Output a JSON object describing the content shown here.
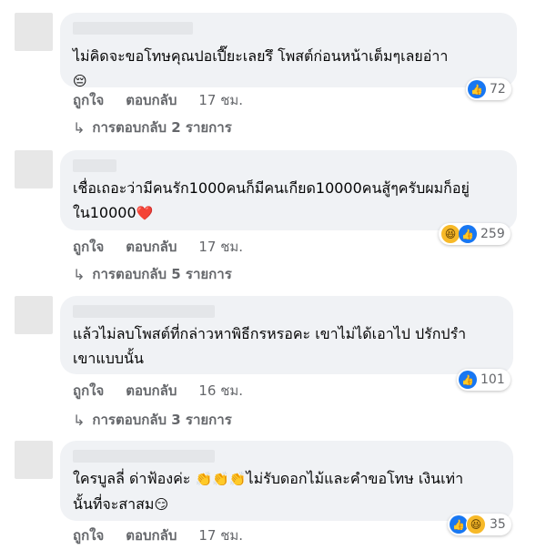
{
  "comments": [
    {
      "text": "ไม่คิดจะขอโทษคุณปอเปี๊ยะเลยรึ โพสต์ก่อนหน้าเต็มๆเลยอ่าา",
      "emoji": "😔",
      "like_label": "ถูกใจ",
      "reply_label": "ตอบกลับ",
      "time": "17 ชม.",
      "reaction_icons": [
        "like-icon"
      ],
      "reaction_count": "72",
      "replies_label": "การตอบกลับ 2 รายการ"
    },
    {
      "text": "เชื่อเถอะว่ามีคนรัก1000คนก็มีคนเกียด10000คนสู้ๆครับผมก็อยู่\nใน10000",
      "emoji": "❤️",
      "like_label": "ถูกใจ",
      "reply_label": "ตอบกลับ",
      "time": "17 ชม.",
      "reaction_icons": [
        "haha-icon",
        "like-icon"
      ],
      "reaction_count": "259",
      "replies_label": "การตอบกลับ 5 รายการ"
    },
    {
      "text": "แล้วไม่ลบโพสต์ที่กล่าวหาพิธีกรหรอคะ เขาไม่ได้เอาไป ปรักปรำ\nเขาแบบนั้น",
      "emoji": "",
      "like_label": "ถูกใจ",
      "reply_label": "ตอบกลับ",
      "time": "16 ชม.",
      "reaction_icons": [
        "like-icon"
      ],
      "reaction_count": "101",
      "replies_label": "การตอบกลับ 3 รายการ"
    },
    {
      "text_a": "ใครบูลลี่ ด่าฟ้องค่ะ",
      "clap": "👏👏👏",
      "text_b": "ไม่รับดอกไม้และคำขอโทษ เงินเท่า\nนั้นที่จะสาสม",
      "emoji": "😏",
      "like_label": "ถูกใจ",
      "reply_label": "ตอบกลับ",
      "time": "17 ชม.",
      "reaction_icons": [
        "like-icon",
        "haha-icon"
      ],
      "reaction_count": "35"
    }
  ],
  "colors": {
    "like": "#1877f2",
    "haha": "#f7b928",
    "bubble": "#f0f2f5",
    "meta": "#65676b"
  }
}
